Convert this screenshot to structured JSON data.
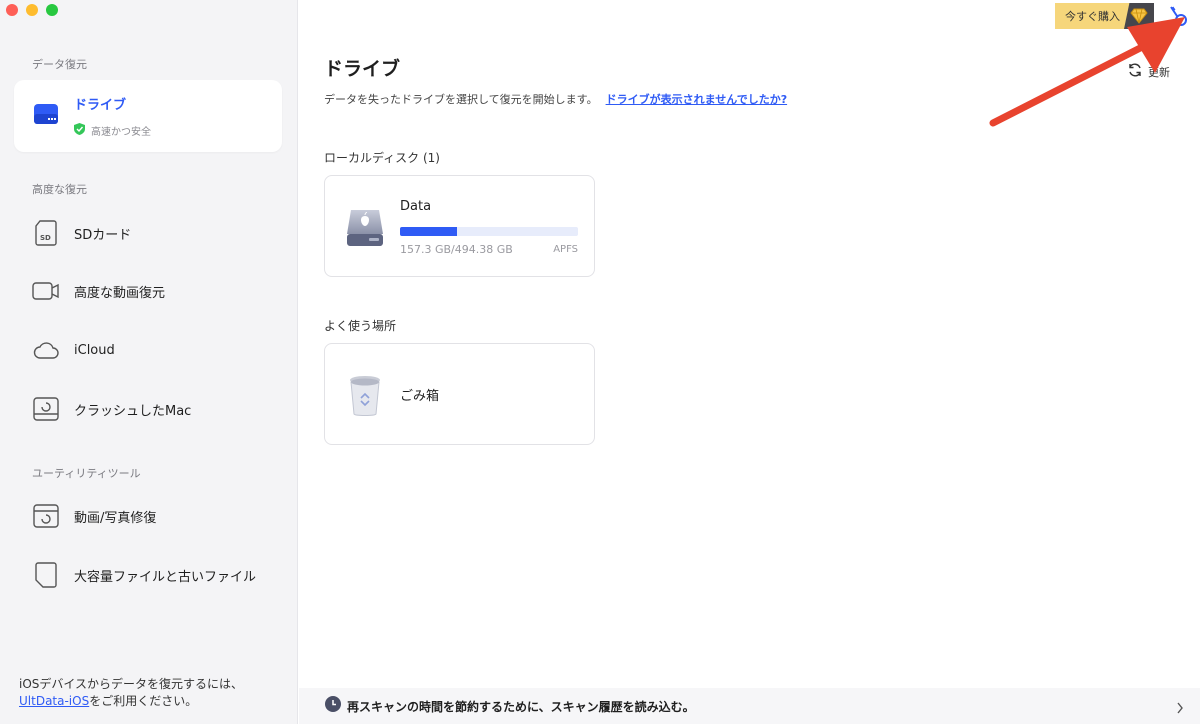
{
  "sidebar": {
    "section_recovery": "データ復元",
    "active_item": {
      "label": "ドライブ",
      "sub": "高速かつ安全",
      "icon": "drive-icon"
    },
    "section_advanced": "高度な復元",
    "advanced_items": [
      {
        "label": "SDカード",
        "icon": "sd-card-icon"
      },
      {
        "label": "高度な動画復元",
        "icon": "video-camera-icon"
      },
      {
        "label": "iCloud",
        "icon": "cloud-icon"
      },
      {
        "label": "クラッシュしたMac",
        "icon": "crashed-mac-icon"
      }
    ],
    "section_utility": "ユーティリティツール",
    "utility_items": [
      {
        "label": "動画/写真修復",
        "icon": "video-repair-icon"
      },
      {
        "label": "大容量ファイルと古いファイル",
        "icon": "file-icon"
      }
    ],
    "bottom_note": {
      "line1": "iOSデバイスからデータを復元するには、",
      "link": "UltData-iOS",
      "line2": "をご利用ください。"
    }
  },
  "header": {
    "buy_label": "今すぐ購入",
    "buy_icon": "diamond-icon",
    "key_icon": "key-icon"
  },
  "main": {
    "title": "ドライブ",
    "subtitle": "データを失ったドライブを選択して復元を開始します。",
    "help_link": "ドライブが表示されませんでしたか?",
    "refresh_label": "更新",
    "local_disk_label": "ローカルディスク (1)",
    "drives": [
      {
        "name": "Data",
        "size": "157.3 GB/494.38 GB",
        "fs": "APFS",
        "used_fraction": 0.318,
        "icon": "apple-drive-icon"
      }
    ],
    "frequent_label": "よく使う場所",
    "places": [
      {
        "name": "ごみ箱",
        "icon": "trash-icon"
      }
    ],
    "history_text": "再スキャンの時間を節約するために、スキャン履歴を読み込む。"
  },
  "colors": {
    "accent": "#2f5bf5",
    "buy": "#f6d67b",
    "arrow": "#e8432e"
  }
}
